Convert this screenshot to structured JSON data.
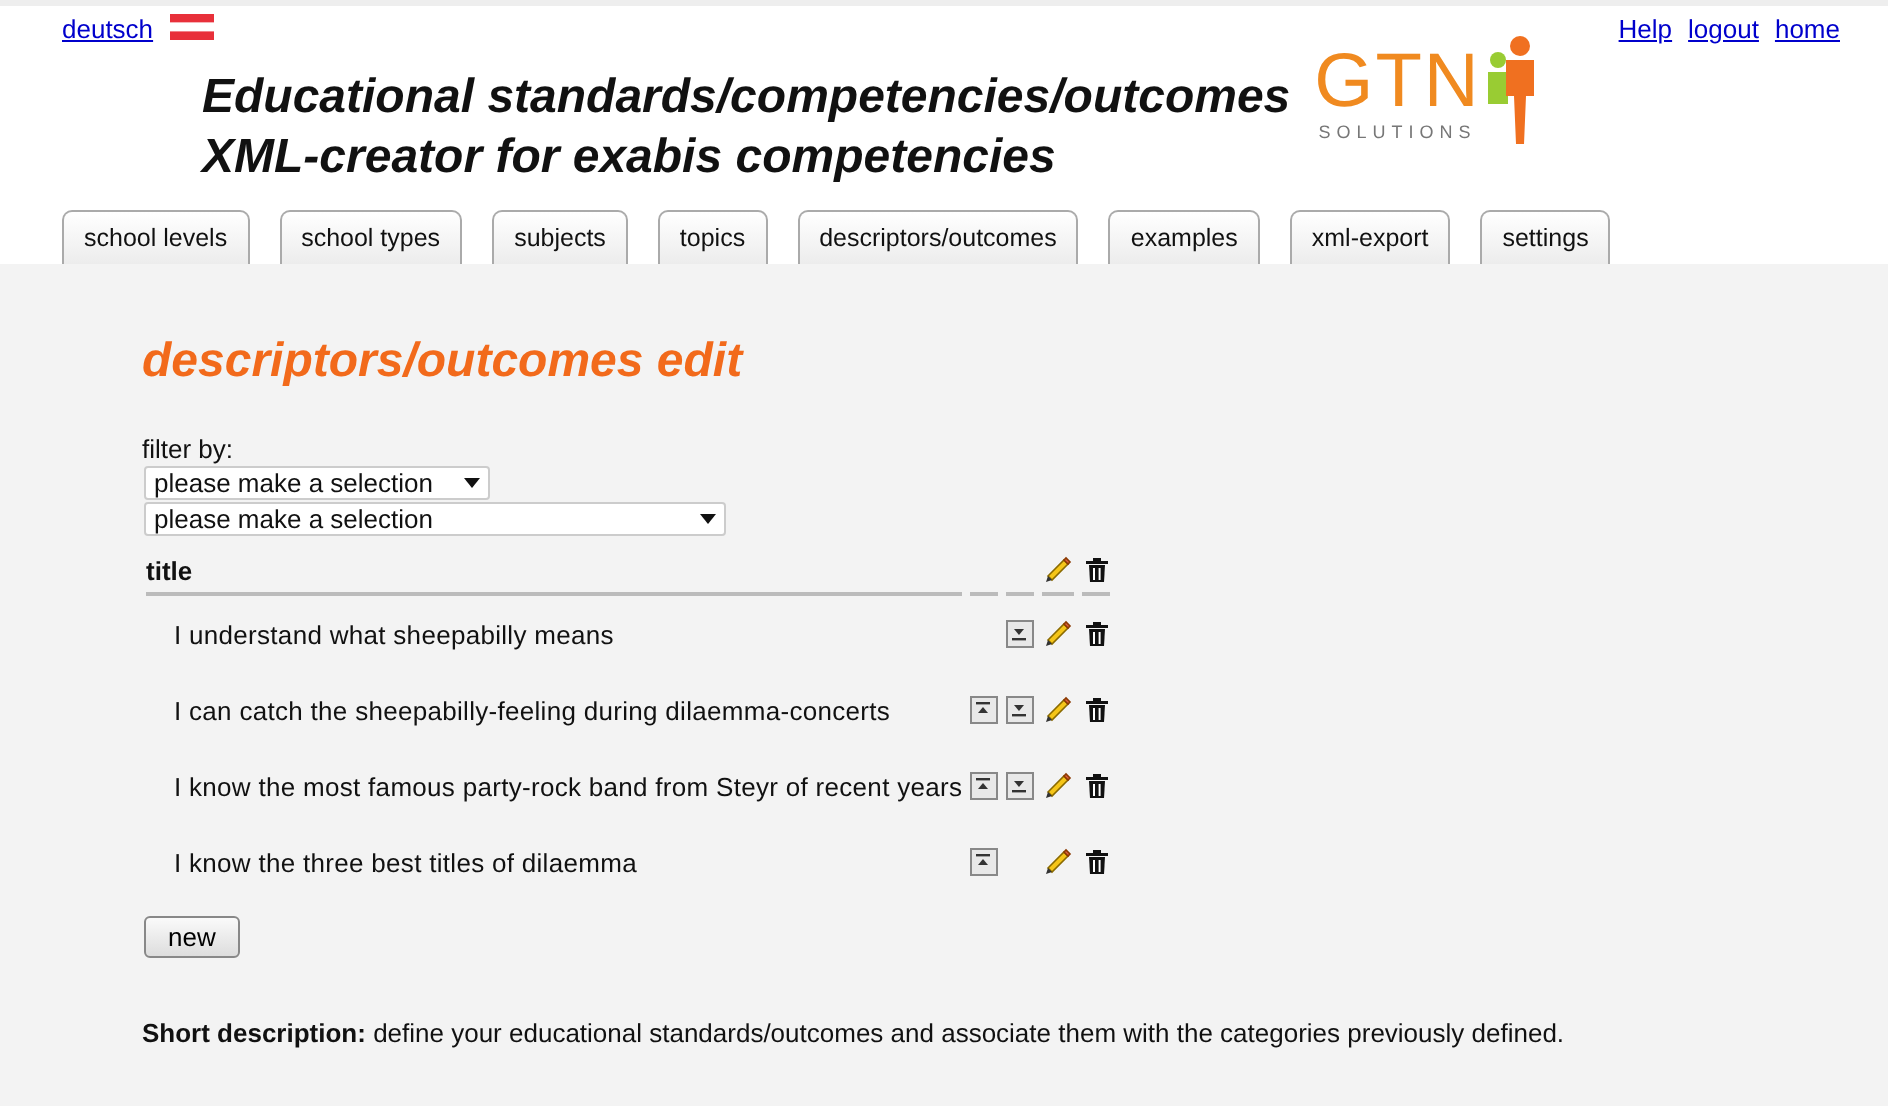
{
  "top_links": {
    "language": "deutsch",
    "right": [
      "Help",
      "logout",
      "home"
    ]
  },
  "header": {
    "title_lines": [
      "Educational standards/competencies/outcomes",
      "XML-creator for exabis competencies"
    ],
    "logo": {
      "name": "GTN",
      "tagline": "SOLUTIONS"
    }
  },
  "tabs": [
    "school levels",
    "school types",
    "subjects",
    "topics",
    "descriptors/outcomes",
    "examples",
    "xml-export",
    "settings"
  ],
  "page_title": "descriptors/outcomes edit",
  "filter": {
    "label": "filter by:",
    "selects": [
      {
        "value": "please make a selection",
        "wide": false
      },
      {
        "value": "please make a selection",
        "wide": true
      }
    ]
  },
  "table": {
    "column": "title",
    "rows": [
      {
        "title": "I understand what sheepabilly means",
        "can_move_up": false,
        "can_move_down": true
      },
      {
        "title": "I can catch the sheepabilly-feeling during dilaemma-concerts",
        "can_move_up": true,
        "can_move_down": true
      },
      {
        "title": "I know the most famous party-rock band from Steyr of recent years",
        "can_move_up": true,
        "can_move_down": true
      },
      {
        "title": "I know the three best titles of dilaemma",
        "can_move_up": true,
        "can_move_down": false
      }
    ]
  },
  "new_button": "new",
  "description": "**Short description:** define your educational standards/outcomes and associate them with the categories previously defined."
}
